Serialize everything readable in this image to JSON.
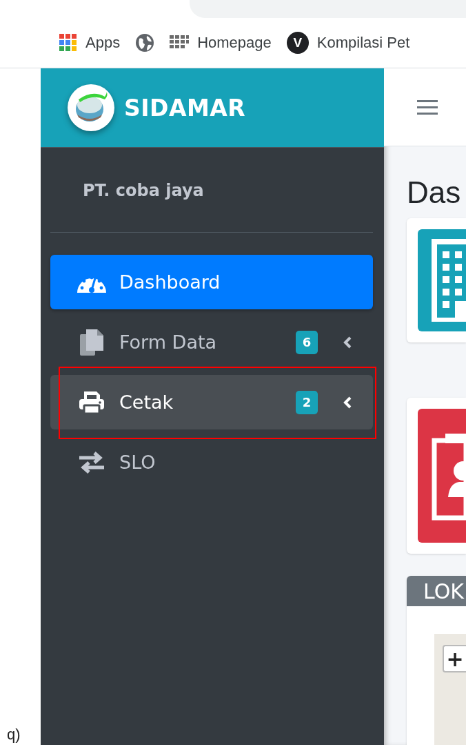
{
  "browser": {
    "bookmarks": [
      {
        "kind": "apps",
        "label": "Apps"
      },
      {
        "kind": "globe"
      },
      {
        "kind": "grid",
        "label": "Homepage"
      },
      {
        "kind": "letter",
        "icon_text": "V",
        "label": "Kompilasi Pet"
      }
    ]
  },
  "figure_label": "q)",
  "sidebar": {
    "brand": "SIDAMAR",
    "user": "PT. coba jaya",
    "items": [
      {
        "kind": "dashboard",
        "label": "Dashboard",
        "selected": true,
        "hovered": false,
        "highlighted": false,
        "expandable": false
      },
      {
        "kind": "files",
        "label": "Form Data",
        "badge": "6",
        "selected": false,
        "hovered": false,
        "highlighted": false,
        "expandable": true
      },
      {
        "kind": "print",
        "label": "Cetak",
        "badge": "2",
        "selected": false,
        "hovered": true,
        "highlighted": true,
        "expandable": true
      },
      {
        "kind": "exchange",
        "label": "SLO",
        "selected": false,
        "hovered": false,
        "highlighted": false,
        "expandable": false
      }
    ]
  },
  "main": {
    "heading": "Das",
    "info_boxes": [
      {
        "kind": "building",
        "color": "#17a2b8"
      },
      {
        "kind": "contact",
        "color": "#dc3545"
      }
    ],
    "card": {
      "title": "LOK",
      "map": {
        "zoom_in": "+"
      }
    }
  }
}
